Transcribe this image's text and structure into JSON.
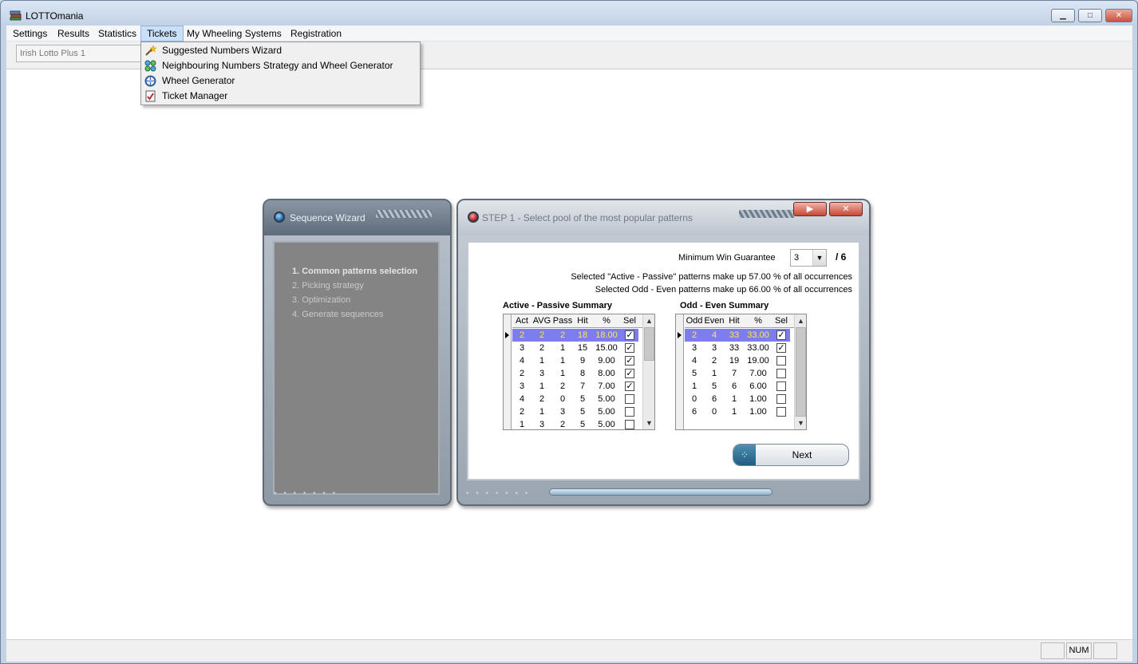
{
  "window": {
    "title": "LOTTOmania",
    "minimize_glyph": "▁",
    "maximize_glyph": "□",
    "close_glyph": "✕"
  },
  "menubar": {
    "items": [
      {
        "label": "Settings"
      },
      {
        "label": "Results"
      },
      {
        "label": "Statistics"
      },
      {
        "label": "Tickets"
      },
      {
        "label": "My Wheeling Systems"
      },
      {
        "label": "Registration"
      }
    ]
  },
  "toolbar": {
    "lottery_select": "Irish Lotto Plus 1"
  },
  "tickets_menu": {
    "items": [
      {
        "label": "Suggested Numbers Wizard",
        "icon": "magic-wand-icon"
      },
      {
        "label": "Neighbouring Numbers Strategy and Wheel Generator",
        "icon": "neighbour-balls-icon"
      },
      {
        "label": "Wheel Generator",
        "icon": "wheel-icon"
      },
      {
        "label": "Ticket Manager",
        "icon": "ticket-check-icon"
      }
    ]
  },
  "wizard": {
    "left_title": "Sequence Wizard",
    "steps": [
      "1. Common patterns selection",
      "2. Picking strategy",
      "3. Optimization",
      "4. Generate sequences"
    ],
    "right_title": "STEP 1 - Select pool of the most popular patterns",
    "title_buttons": {
      "next_glyph": "▶",
      "close_glyph": "✕"
    },
    "min_win_label": "Minimum Win Guarantee",
    "min_win_value": "3",
    "min_win_total": "/ 6",
    "summary_line_1": "Selected \"Active - Passive\" patterns make up 57.00 % of all occurrences",
    "summary_line_2": "Selected Odd - Even patterns make up 66.00 % of all occurrences",
    "active_passive": {
      "title": "Active - Passive Summary",
      "headers": [
        "Act",
        "AVG",
        "Pass",
        "Hit",
        "%",
        "Sel"
      ],
      "rows": [
        {
          "act": "2",
          "avg": "2",
          "pass": "2",
          "hit": "18",
          "pct": "18.00",
          "sel": true
        },
        {
          "act": "3",
          "avg": "2",
          "pass": "1",
          "hit": "15",
          "pct": "15.00",
          "sel": true
        },
        {
          "act": "4",
          "avg": "1",
          "pass": "1",
          "hit": "9",
          "pct": "9.00",
          "sel": true
        },
        {
          "act": "2",
          "avg": "3",
          "pass": "1",
          "hit": "8",
          "pct": "8.00",
          "sel": true
        },
        {
          "act": "3",
          "avg": "1",
          "pass": "2",
          "hit": "7",
          "pct": "7.00",
          "sel": true
        },
        {
          "act": "4",
          "avg": "2",
          "pass": "0",
          "hit": "5",
          "pct": "5.00",
          "sel": false
        },
        {
          "act": "2",
          "avg": "1",
          "pass": "3",
          "hit": "5",
          "pct": "5.00",
          "sel": false
        },
        {
          "act": "1",
          "avg": "3",
          "pass": "2",
          "hit": "5",
          "pct": "5.00",
          "sel": false
        }
      ]
    },
    "odd_even": {
      "title": "Odd - Even Summary",
      "headers": [
        "Odd",
        "Even",
        "Hit",
        "%",
        "Sel"
      ],
      "rows": [
        {
          "odd": "2",
          "even": "4",
          "hit": "33",
          "pct": "33.00",
          "sel": true
        },
        {
          "odd": "3",
          "even": "3",
          "hit": "33",
          "pct": "33.00",
          "sel": true
        },
        {
          "odd": "4",
          "even": "2",
          "hit": "19",
          "pct": "19.00",
          "sel": false
        },
        {
          "odd": "5",
          "even": "1",
          "hit": "7",
          "pct": "7.00",
          "sel": false
        },
        {
          "odd": "1",
          "even": "5",
          "hit": "6",
          "pct": "6.00",
          "sel": false
        },
        {
          "odd": "0",
          "even": "6",
          "hit": "1",
          "pct": "1.00",
          "sel": false
        },
        {
          "odd": "6",
          "even": "0",
          "hit": "1",
          "pct": "1.00",
          "sel": false
        }
      ]
    },
    "next_label": "Next"
  },
  "statusbar": {
    "num_indicator": "NUM"
  }
}
